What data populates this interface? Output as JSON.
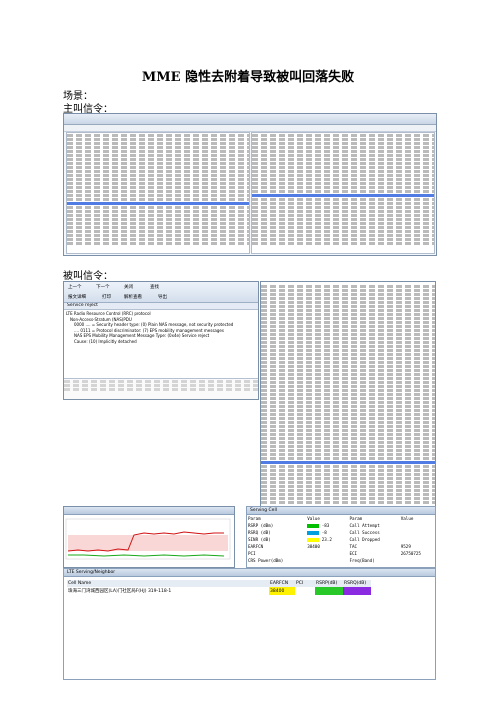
{
  "doc": {
    "title": "MME 隐性去附着导致被叫回落失败",
    "scene_label": "场景：",
    "caller_label": "主叫信令：",
    "callee_label": "被叫信令："
  },
  "callee_window": {
    "toolbar": {
      "btn_prev": "上一个",
      "btn_next": "下一个",
      "btn_msg_browse": "报文详细",
      "btn_print": "打印",
      "btn_explain": "解析查看",
      "btn_export": "导出",
      "btn_close": "关闭",
      "btn_search": "查找"
    },
    "tree_tab": "Service reject",
    "tree_lines": [
      "LTE Radio Resource Control (RRC) protocol",
      "Non-Access-Stratum (NAS)PDU",
      "0000 .... = Security header type: (0) Plain NAS message, not security protected",
      ".... 0111 = Protocol discriminator: (7) EPS mobility management messages",
      "NAS EPS Mobility Management Message Type: (0x4e) Service reject",
      "Cause: (10) Implicitly detached"
    ]
  },
  "serving_cell": {
    "title": "Serving Cell",
    "headers": [
      "Param",
      "Value",
      "Param",
      "Value"
    ],
    "rows": [
      [
        "RSRP (dBm)",
        "-83",
        "Call Attempt",
        ""
      ],
      [
        "RSRQ (dB)",
        "-8",
        "Call Success",
        ""
      ],
      [
        "SINR (dB)",
        "23.2",
        "Call Dropped",
        ""
      ],
      [
        "EARFCN",
        "38400",
        "TAC",
        "9529"
      ],
      [
        "PCI",
        "",
        "ECI",
        "26750725"
      ],
      [
        "CRS Power(dBm)",
        "",
        "Freq(Band)",
        ""
      ]
    ]
  },
  "neighbor": {
    "title": "LTE Serving/Neighbor",
    "headers": [
      "Cell Name",
      "EARFCN",
      "PCI",
      "RSRP(dB)",
      "RSRQ(dB)"
    ],
    "row": [
      "珠海三门湾城西园区(LA)门社区局F(HJ) 319-118-1",
      "38400",
      "",
      "",
      ""
    ]
  },
  "colors": {
    "rsrp": "#00c000",
    "rsrq": "#00a0e0",
    "sinr": "#ffff00",
    "chart_red": "#d01010",
    "chart_green": "#18a818",
    "highlight": "#316ac5"
  }
}
